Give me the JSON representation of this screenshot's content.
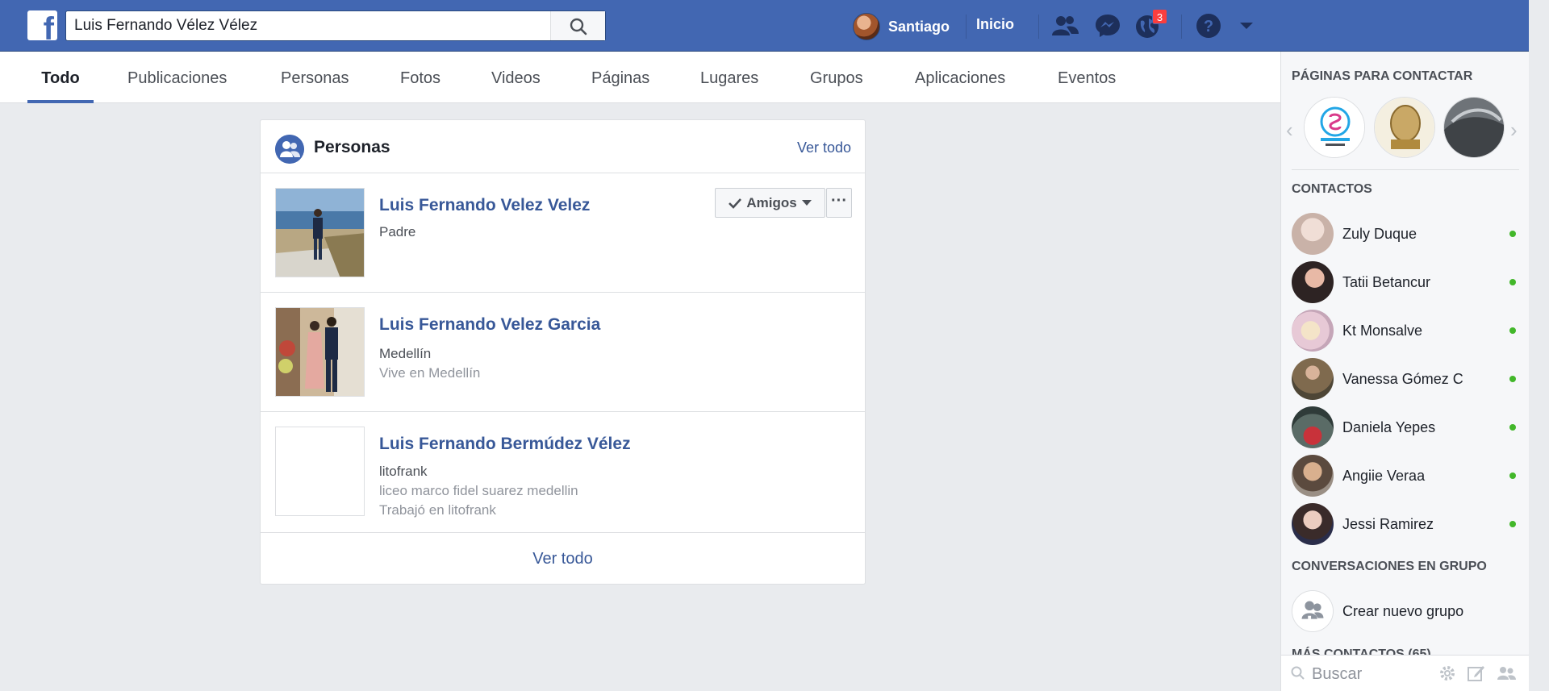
{
  "search": {
    "value": "Luis Fernando Vélez Vélez"
  },
  "topnav": {
    "user_name": "Santiago",
    "home_label": "Inicio",
    "notification_count": "3"
  },
  "tabs": [
    {
      "label": "Todo",
      "active": true
    },
    {
      "label": "Publicaciones"
    },
    {
      "label": "Personas"
    },
    {
      "label": "Fotos"
    },
    {
      "label": "Videos"
    },
    {
      "label": "Páginas"
    },
    {
      "label": "Lugares"
    },
    {
      "label": "Grupos"
    },
    {
      "label": "Aplicaciones"
    },
    {
      "label": "Eventos"
    }
  ],
  "results": {
    "title": "Personas",
    "see_all_top": "Ver todo",
    "see_all_bottom": "Ver todo",
    "people": [
      {
        "name": "Luis Fernando Velez Velez",
        "lines": [
          "Padre"
        ],
        "action": "Amigos"
      },
      {
        "name": "Luis Fernando Velez Garcia",
        "lines": [
          "Medellín",
          "Vive en Medellín"
        ]
      },
      {
        "name": "Luis Fernando Bermúdez Vélez",
        "lines": [
          "litofrank",
          "liceo marco fidel suarez medellin",
          "Trabajó en litofrank"
        ]
      }
    ]
  },
  "sidebar": {
    "pages_heading": "PÁGINAS PARA CONTACTAR",
    "contacts_heading": "CONTACTOS",
    "contacts": [
      {
        "name": "Zuly Duque",
        "online": true
      },
      {
        "name": "Tatii Betancur",
        "online": true
      },
      {
        "name": "Kt Monsalve",
        "online": true
      },
      {
        "name": "Vanessa Gómez C",
        "online": true
      },
      {
        "name": "Daniela Yepes",
        "online": true
      },
      {
        "name": "Angiie Veraa",
        "online": true
      },
      {
        "name": "Jessi Ramirez",
        "online": true
      }
    ],
    "groups_heading": "CONVERSACIONES EN GRUPO",
    "new_group_label": "Crear nuevo grupo",
    "more_contacts_heading": "MÁS CONTACTOS (65)",
    "search_placeholder": "Buscar"
  },
  "colors": {
    "brand": "#4267b2",
    "link": "#385898",
    "online": "#42b72a",
    "badge": "#fa3e3e"
  }
}
